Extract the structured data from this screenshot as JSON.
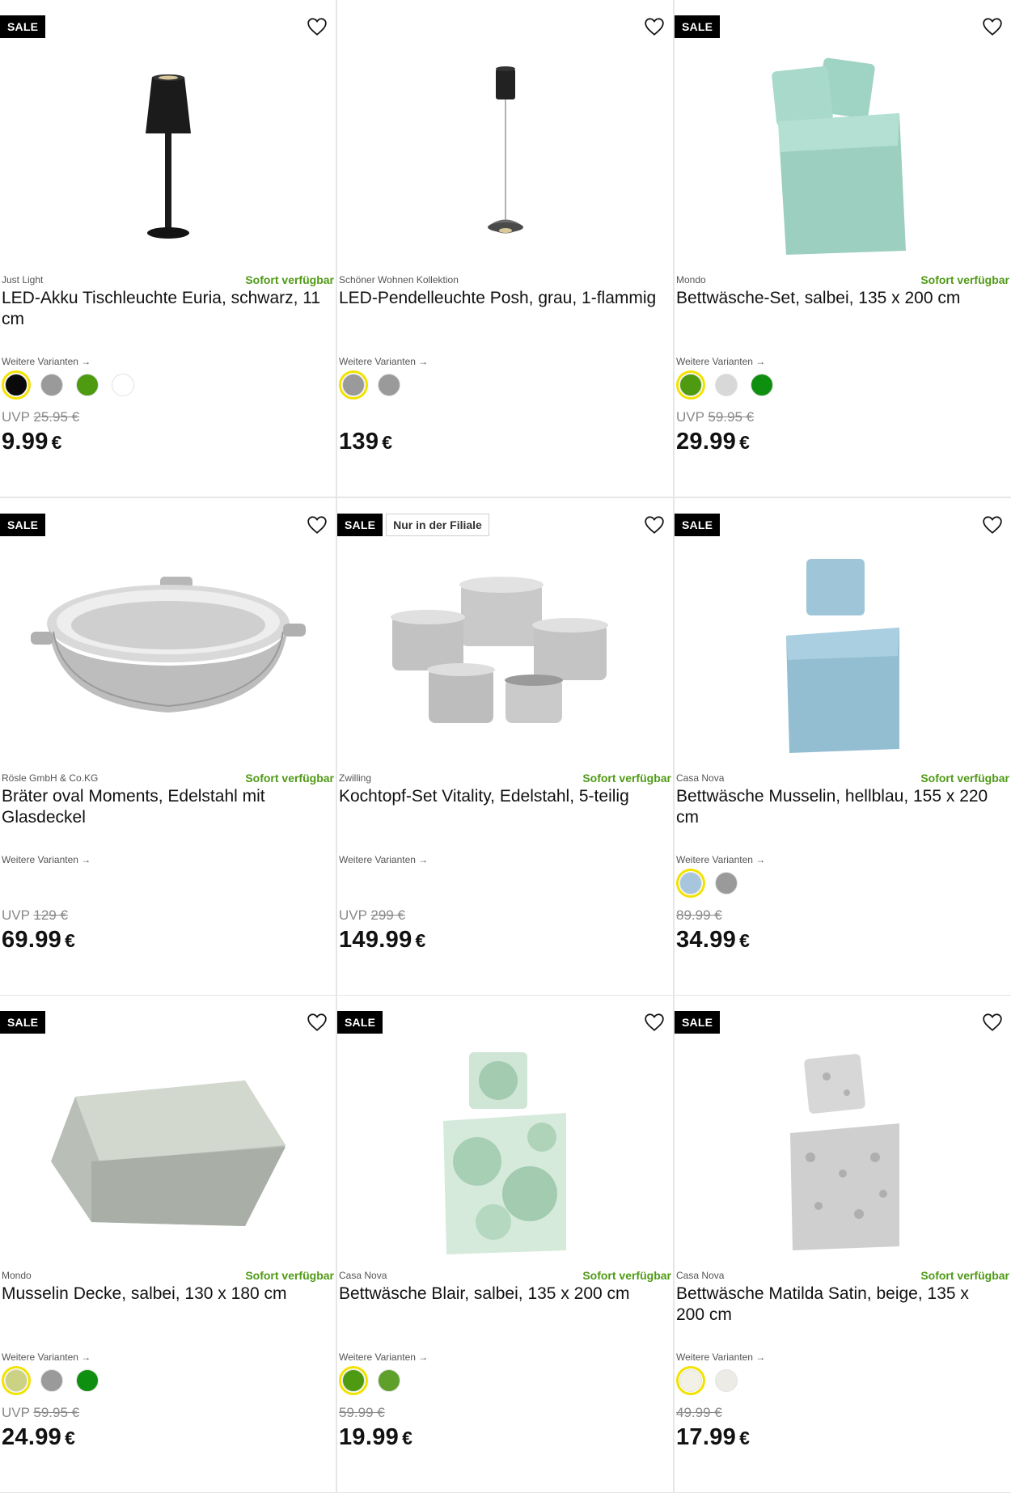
{
  "labels": {
    "sale": "SALE",
    "variants": "Weitere Varianten →",
    "uvp": "UVP",
    "currency": "€"
  },
  "colors": {
    "accent_available": "#4f9a15",
    "selected_ring": "#f2e200"
  },
  "products": [
    {
      "brand": "Just Light",
      "availability": "Sofort verfügbar",
      "title": "LED-Akku Tischleuchte Euria, schwarz, 11 cm",
      "badges": [
        "SALE"
      ],
      "show_variants": true,
      "variants": [
        {
          "color": "#0a0a0a",
          "selected": true
        },
        {
          "color": "#9a9a9a"
        },
        {
          "color": "#4e9a10"
        },
        {
          "color": "#ffffff"
        }
      ],
      "uvp_label": "UVP",
      "old_price": "25.95 €",
      "price": "9.99",
      "image_icon": "table-lamp"
    },
    {
      "brand": "Schöner Wohnen Kollektion",
      "availability": "",
      "title": "LED-Pendelleuchte Posh, grau, 1-flammig",
      "badges": [],
      "show_variants": true,
      "variants": [
        {
          "color": "#9a9a9a",
          "selected": true
        },
        {
          "color": "#9a9a9a"
        }
      ],
      "uvp_label": "",
      "old_price": "",
      "price": "139",
      "image_icon": "pendant-lamp"
    },
    {
      "brand": "Mondo",
      "availability": "Sofort verfügbar",
      "title": "Bettwäsche-Set, salbei, 135 x 200 cm",
      "badges": [
        "SALE"
      ],
      "show_variants": true,
      "variants": [
        {
          "color": "#4e9a10",
          "selected": true
        },
        {
          "color": "#d8d8d8"
        },
        {
          "color": "#0f8f0f"
        }
      ],
      "uvp_label": "UVP",
      "old_price": "59.95 €",
      "price": "29.99",
      "image_icon": "bedding-mint"
    },
    {
      "brand": "Rösle GmbH & Co.KG",
      "availability": "Sofort verfügbar",
      "title": "Bräter oval Moments, Edelstahl mit Glasdeckel",
      "badges": [
        "SALE"
      ],
      "show_variants": false,
      "variants": [],
      "uvp_label": "UVP",
      "old_price": "129 €",
      "price": "69.99",
      "image_icon": "roasting-pan"
    },
    {
      "brand": "Zwilling",
      "availability": "Sofort verfügbar",
      "title": "Kochtopf-Set Vitality, Edelstahl, 5-teilig",
      "badges": [
        "SALE",
        "Nur in der Filiale"
      ],
      "show_variants": false,
      "variants": [],
      "uvp_label": "UVP",
      "old_price": "299 €",
      "price": "149.99",
      "image_icon": "cookware-set"
    },
    {
      "brand": "Casa Nova",
      "availability": "Sofort verfügbar",
      "title": "Bettwäsche Musselin, hellblau, 155 x 220 cm",
      "badges": [
        "SALE"
      ],
      "show_variants": true,
      "variants": [
        {
          "color": "#a7c6dd",
          "selected": true
        },
        {
          "color": "#9a9a9a"
        }
      ],
      "uvp_label": "",
      "old_price": "89.99 €",
      "price": "34.99",
      "image_icon": "bedding-blue"
    },
    {
      "brand": "Mondo",
      "availability": "Sofort verfügbar",
      "title": "Musselin Decke, salbei, 130 x 180 cm",
      "badges": [
        "SALE"
      ],
      "show_variants": true,
      "variants": [
        {
          "color": "#cbd283",
          "selected": true
        },
        {
          "color": "#9a9a9a"
        },
        {
          "color": "#0f8f0f"
        }
      ],
      "uvp_label": "UVP",
      "old_price": "59.95 €",
      "price": "24.99",
      "image_icon": "blanket"
    },
    {
      "brand": "Casa Nova",
      "availability": "Sofort verfügbar",
      "title": "Bettwäsche Blair, salbei, 135 x 200 cm",
      "badges": [
        "SALE"
      ],
      "show_variants": true,
      "variants": [
        {
          "color": "#4e9a10",
          "selected": true
        },
        {
          "color": "#5ea02a"
        }
      ],
      "uvp_label": "",
      "old_price": "59.99 €",
      "price": "19.99",
      "image_icon": "bedding-floral"
    },
    {
      "brand": "Casa Nova",
      "availability": "Sofort verfügbar",
      "title": "Bettwäsche Matilda Satin, beige, 135 x 200 cm",
      "badges": [
        "SALE"
      ],
      "show_variants": true,
      "variants": [
        {
          "color": "#f3f0e6",
          "selected": true
        },
        {
          "color": "#ecebe6"
        }
      ],
      "uvp_label": "",
      "old_price": "49.99 €",
      "price": "17.99",
      "image_icon": "bedding-grey"
    }
  ]
}
